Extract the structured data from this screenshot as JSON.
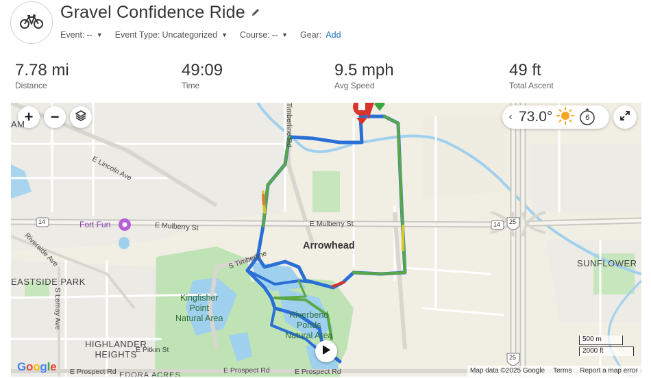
{
  "activity": {
    "title": "Gravel Confidence Ride",
    "icon": "bicycle-icon"
  },
  "meta": {
    "event_label": "Event:",
    "event_value": "--",
    "event_type_label": "Event Type:",
    "event_type_value": "Uncategorized",
    "course_label": "Course:",
    "course_value": "--",
    "gear_label": "Gear:",
    "gear_action": "Add"
  },
  "stats": [
    {
      "value": "7.78 mi",
      "label": "Distance"
    },
    {
      "value": "49:09",
      "label": "Time"
    },
    {
      "value": "9.5 mph",
      "label": "Avg Speed"
    },
    {
      "value": "49 ft",
      "label": "Total Ascent"
    }
  ],
  "map": {
    "zoom_in": "+",
    "zoom_out": "−",
    "weather_temp": "73.0°",
    "wind_value": "6",
    "places": {
      "amhurst": "AM",
      "eastside_park": "EASTSIDE PARK",
      "highlander_heights": "HIGHLANDER\nHEIGHTS",
      "sunflower": "SUNFLOWER",
      "arrowhead": "Arrowhead",
      "kingfisher": "Kingfisher\nPoint\nNatural Area",
      "riverbend": "Riverbend\nPonds\nNatural Area",
      "fort_fun": "Fort Fun",
      "lincoln_ave": "E Lincoln Ave",
      "mulberry_w": "E Mulberry St",
      "mulberry_e": "E Mulberry St",
      "riverside_ave": "Riverside Ave",
      "lemay_ave": "S Lemay Ave",
      "pitkin": "E Pitkin St",
      "timberline_s": "S Timberline",
      "timberline_n": "Timberline Rd",
      "prospect_w": "E Prospect Rd",
      "prospect_mid": "E Prospect Rd",
      "prospect_e": "E Prospect Rd",
      "edora": "EDORA ACRES",
      "hwy14_w": "14",
      "hwy14_e": "14",
      "i25_n": "25",
      "i25_s": "25"
    },
    "scale_metric": "500 m",
    "scale_imperial": "2000 ft",
    "google_logo": "Google",
    "attribution": {
      "map_data": "Map data ©2025 Google",
      "terms": "Terms",
      "report": "Report a map error"
    },
    "colors": {
      "route_blue": "#2a6fd6",
      "route_green": "#5aa843",
      "route_yellow": "#d9c82a",
      "route_red": "#d8342b",
      "park_green": "#bfe3b4",
      "water_blue": "#9fd0ee"
    }
  }
}
